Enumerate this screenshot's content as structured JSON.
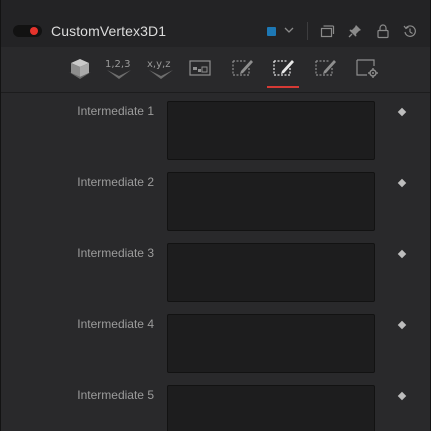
{
  "window": {
    "title": "CustomVertex3D1",
    "accent_color": "#1d78b5",
    "enable_dot_color": "#e5332c"
  },
  "header_icons": [
    "enable-toggle",
    "color-swatch",
    "chevron-down-icon",
    "duplicate-icon",
    "pin-icon",
    "lock-icon",
    "reset-icon"
  ],
  "tabs": [
    {
      "name": "tab-shape",
      "icon": "cube-icon"
    },
    {
      "name": "tab-numbers",
      "text": "1,2,3"
    },
    {
      "name": "tab-xyz",
      "text": "x,y,z"
    },
    {
      "name": "tab-image",
      "icon": "image-icon"
    },
    {
      "name": "tab-setup",
      "icon": "pencil-edit-icon"
    },
    {
      "name": "tab-intermediate",
      "icon": "pencil-edit-icon",
      "active": true
    },
    {
      "name": "tab-vertex",
      "icon": "pencil-edit-icon"
    },
    {
      "name": "tab-settings",
      "icon": "settings-window-icon"
    }
  ],
  "rows": [
    {
      "label": "Intermediate 1",
      "value": ""
    },
    {
      "label": "Intermediate 2",
      "value": ""
    },
    {
      "label": "Intermediate 3",
      "value": ""
    },
    {
      "label": "Intermediate 4",
      "value": ""
    },
    {
      "label": "Intermediate 5",
      "value": ""
    }
  ],
  "tab_text": {
    "numbers": "1,2,3",
    "xyz": "x,y,z"
  }
}
